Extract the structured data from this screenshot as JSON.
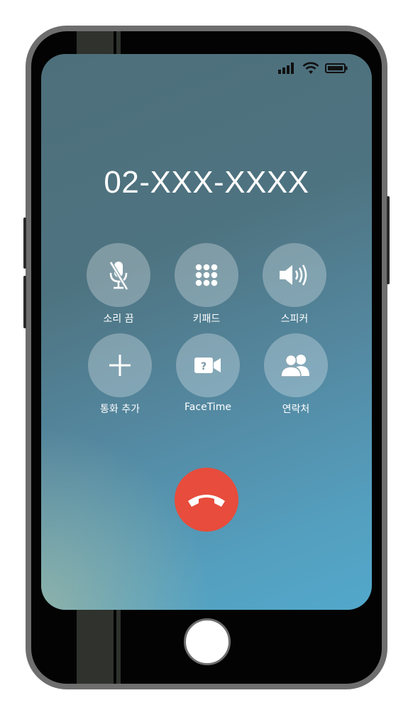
{
  "call": {
    "number": "02-XXX-XXXX"
  },
  "controls": [
    {
      "label": "소리 끔",
      "icon": "mute-microphone-icon"
    },
    {
      "label": "키패드",
      "icon": "keypad-icon"
    },
    {
      "label": "스피커",
      "icon": "speaker-icon"
    },
    {
      "label": "통화 추가",
      "icon": "add-call-icon"
    },
    {
      "label": "FaceTime",
      "icon": "facetime-video-icon"
    },
    {
      "label": "연락처",
      "icon": "contacts-icon"
    }
  ],
  "status_bar": {
    "icons": [
      "signal-icon",
      "wifi-icon",
      "battery-icon"
    ]
  },
  "colors": {
    "end_call": "#e74c3c",
    "control_circle": "rgba(255,255,255,0.28)",
    "text": "#ffffff"
  }
}
